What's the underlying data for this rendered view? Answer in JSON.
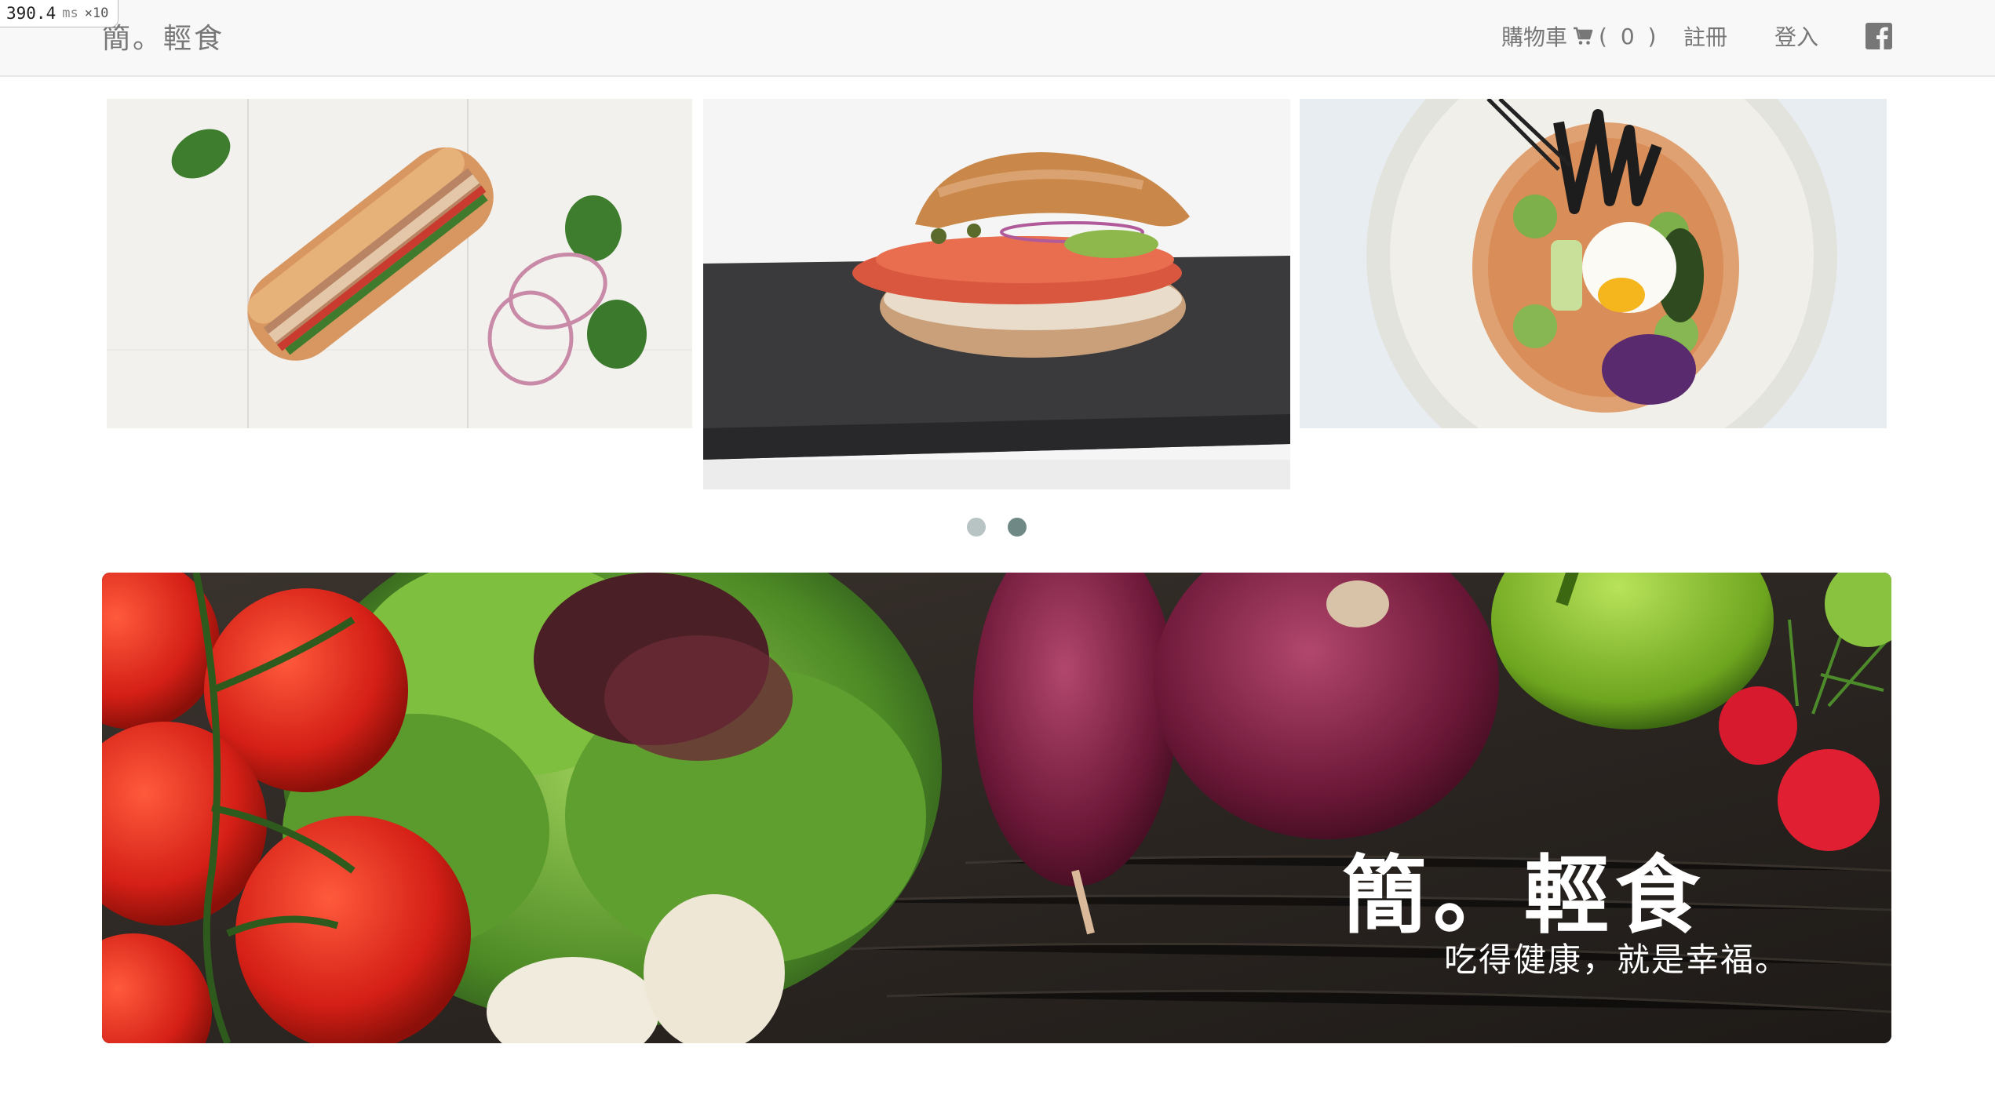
{
  "perf": {
    "value": "390.4",
    "unit": "ms",
    "multiplier": "×10"
  },
  "navbar": {
    "brand": "簡。輕食",
    "cart_label": "購物車",
    "cart_count": "( 0 )",
    "register": "註冊",
    "login": "登入",
    "facebook_icon": "facebook-icon"
  },
  "carousel": {
    "slides": [
      {
        "name": "chicken-sub-sandwich"
      },
      {
        "name": "salmon-bagel-sandwich"
      },
      {
        "name": "egg-grain-bowl"
      }
    ],
    "dots": 2,
    "active_dot": 2
  },
  "hero": {
    "title": "簡。輕食",
    "subtitle": "吃得健康，就是幸福。"
  },
  "colors": {
    "navbar_bg": "#f8f8f8",
    "nav_text": "#777777",
    "dot_inactive": "#b7c4c3",
    "dot_active": "#6f8886",
    "hero_text": "#ffffff"
  }
}
